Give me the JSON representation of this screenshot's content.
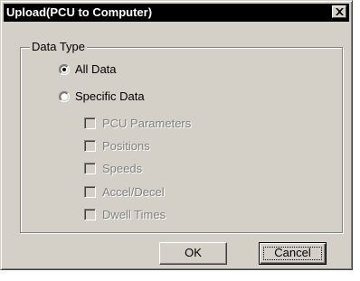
{
  "window": {
    "title": "Upload(PCU to Computer)",
    "close_icon": "close-icon"
  },
  "group": {
    "legend": "Data Type"
  },
  "radios": [
    {
      "label": "All Data",
      "selected": true
    },
    {
      "label": "Specific Data",
      "selected": false
    }
  ],
  "checkboxes": [
    {
      "label": "PCU Parameters",
      "checked": false,
      "disabled": true
    },
    {
      "label": "Positions",
      "checked": false,
      "disabled": true
    },
    {
      "label": "Speeds",
      "checked": false,
      "disabled": true
    },
    {
      "label": "Accel/Decel",
      "checked": false,
      "disabled": true
    },
    {
      "label": "Dwell Times",
      "checked": false,
      "disabled": true
    }
  ],
  "buttons": {
    "ok_label": "OK",
    "cancel_label": "Cancel"
  }
}
